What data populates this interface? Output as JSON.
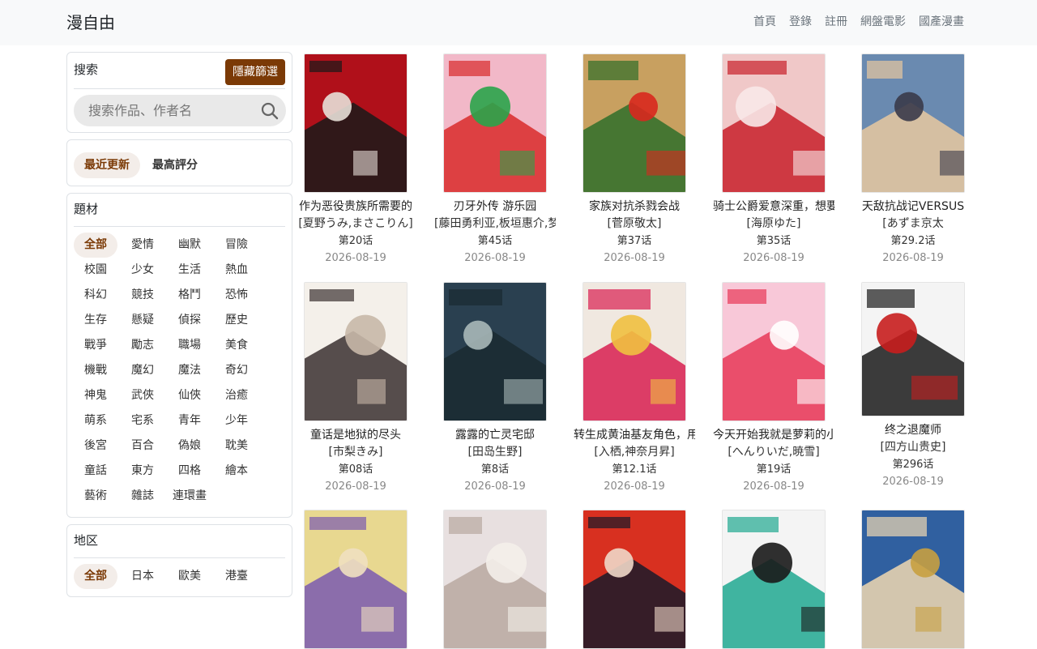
{
  "navbar": {
    "brand": "漫自由",
    "links": [
      "首頁",
      "登錄",
      "註冊",
      "網盤電影",
      "國產漫畫"
    ]
  },
  "search": {
    "title": "搜索",
    "hide_filter_label": "隱藏篩選",
    "placeholder": "搜索作品、作者名",
    "value": ""
  },
  "sort": {
    "tabs": [
      "最近更新",
      "最高評分"
    ],
    "active": 0
  },
  "genre": {
    "title": "題材",
    "tags": [
      "全部",
      "愛情",
      "幽默",
      "冒險",
      "校園",
      "少女",
      "生活",
      "熱血",
      "科幻",
      "競技",
      "格鬥",
      "恐怖",
      "生存",
      "懸疑",
      "偵探",
      "歷史",
      "戰爭",
      "勵志",
      "職場",
      "美食",
      "機戰",
      "魔幻",
      "魔法",
      "奇幻",
      "神鬼",
      "武俠",
      "仙俠",
      "治癒",
      "萌系",
      "宅系",
      "青年",
      "少年",
      "後宮",
      "百合",
      "偽娘",
      "耽美",
      "童話",
      "東方",
      "四格",
      "繪本",
      "藝術",
      "雜誌",
      "連環畫"
    ],
    "active": 0
  },
  "region": {
    "title": "地区",
    "tags": [
      "全部",
      "日本",
      "歐美",
      "港臺"
    ],
    "active": 0
  },
  "manga": [
    {
      "title": "作为恶役贵族所需要的",
      "author": "[夏野うみ,まさこりん]",
      "episode": "第20话",
      "date": "2026-08-19",
      "colors": [
        "#b0101a",
        "#1a1a1a",
        "#e8e0d8"
      ]
    },
    {
      "title": "刃牙外传 游乐园",
      "author": "[藤田勇利亚,板垣惠介,梦",
      "episode": "第45话",
      "date": "2026-08-19",
      "colors": [
        "#f2b8c8",
        "#d92a2a",
        "#2aa44a"
      ]
    },
    {
      "title": "家族对抗杀戮会战",
      "author": "[菅原敬太]",
      "episode": "第37话",
      "date": "2026-08-19",
      "colors": [
        "#c8a060",
        "#2f6e2a",
        "#d8281e"
      ]
    },
    {
      "title": "骑士公爵爱意深重，想要",
      "author": "[海原ゆた]",
      "episode": "第35话",
      "date": "2026-08-19",
      "colors": [
        "#f0c8c8",
        "#c8202a",
        "#f8e8e8"
      ]
    },
    {
      "title": "天敌抗战记VERSUS",
      "author": "[あずま京太",
      "episode": "第29.2话",
      "date": "2026-08-19",
      "colors": [
        "#6a8ab0",
        "#e8c8a0",
        "#3a3a4a"
      ]
    },
    {
      "title": "童话是地狱的尽头",
      "author": "[市梨きみ]",
      "episode": "第08话",
      "date": "2026-08-19",
      "colors": [
        "#f4f0ea",
        "#3a3030",
        "#c8b8a8"
      ]
    },
    {
      "title": "露露的亡灵宅邸",
      "author": "[田岛生野]",
      "episode": "第8话",
      "date": "2026-08-19",
      "colors": [
        "#2a4050",
        "#1a2a30",
        "#a8b8b8"
      ]
    },
    {
      "title": "转生成黄油基友角色，用",
      "author": "[入栖,神奈月昇]",
      "episode": "第12.1话",
      "date": "2026-08-19",
      "colors": [
        "#f0e8e0",
        "#d81e50",
        "#f0c040"
      ]
    },
    {
      "title": "今天开始我就是萝莉的小",
      "author": "[へんりいだ,暁雪]",
      "episode": "第19话",
      "date": "2026-08-19",
      "colors": [
        "#f8c8d8",
        "#e83858",
        "#ffffff"
      ]
    },
    {
      "title": "终之退魔师",
      "author": "[四方山贵史]",
      "episode": "第296话",
      "date": "2026-08-19",
      "colors": [
        "#f4f4f4",
        "#1a1a1a",
        "#c81e1e"
      ]
    },
    {
      "title": "",
      "author": "",
      "episode": "",
      "date": "",
      "colors": [
        "#e8d890",
        "#7a5ab0",
        "#f0e0c0"
      ]
    },
    {
      "title": "",
      "author": "",
      "episode": "",
      "date": "",
      "colors": [
        "#e8e0e0",
        "#b8a8a0",
        "#f4f0ea"
      ]
    },
    {
      "title": "",
      "author": "",
      "episode": "",
      "date": "",
      "colors": [
        "#d83020",
        "#1a1a2a",
        "#f0d8c8"
      ]
    },
    {
      "title": "",
      "author": "",
      "episode": "",
      "date": "",
      "colors": [
        "#f4f4f4",
        "#20a890",
        "#1a1a1a"
      ]
    },
    {
      "title": "",
      "author": "",
      "episode": "",
      "date": "",
      "colors": [
        "#3060a0",
        "#f0d8b0",
        "#c8a040"
      ]
    }
  ]
}
